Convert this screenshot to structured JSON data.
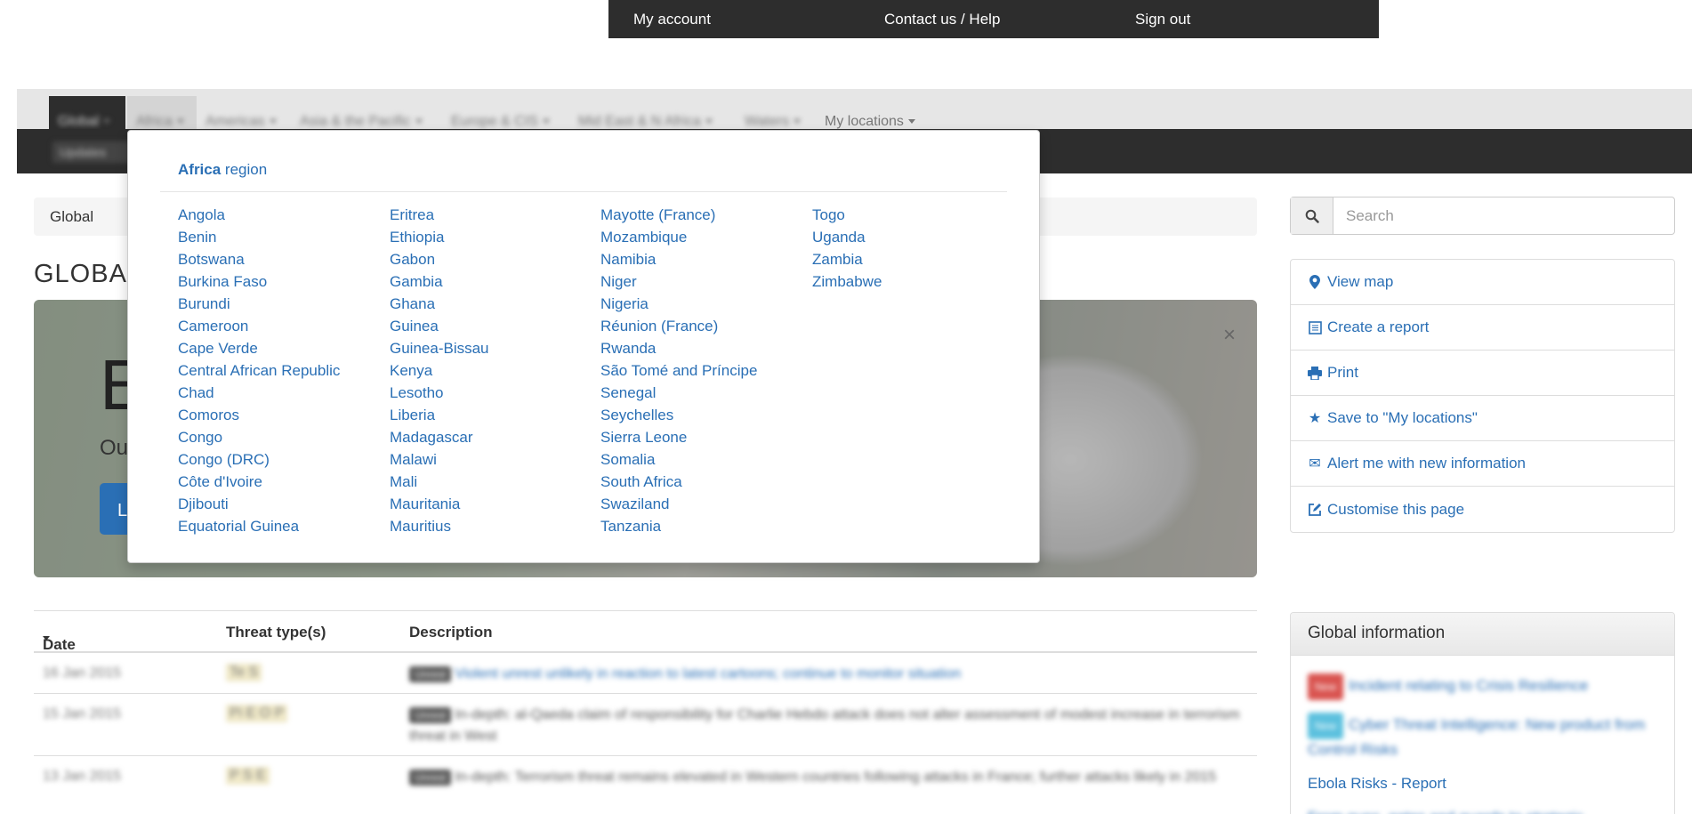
{
  "topbar": {
    "my_account": "My account",
    "contact": "Contact us / Help",
    "sign_out": "Sign out"
  },
  "nav": {
    "regions": [
      "Global",
      "Africa",
      "Americas",
      "Asia & the Pacific",
      "Europe & CIS",
      "Mid East & N Africa",
      "Waters"
    ],
    "my_locations": "My locations",
    "sub_items": [
      "Updates"
    ]
  },
  "breadcrumb": {
    "current": "Global"
  },
  "page_title": "GLOBA",
  "banner": {
    "headline": "E",
    "subline": "Ou",
    "button_label": "L",
    "close": "×"
  },
  "dropdown": {
    "header_bold": "Africa",
    "header_rest": " region",
    "columns": [
      [
        "Angola",
        "Benin",
        "Botswana",
        "Burkina Faso",
        "Burundi",
        "Cameroon",
        "Cape Verde",
        "Central African Republic",
        "Chad",
        "Comoros",
        "Congo",
        "Congo (DRC)",
        "Côte d'Ivoire",
        "Djibouti",
        "Equatorial Guinea"
      ],
      [
        "Eritrea",
        "Ethiopia",
        "Gabon",
        "Gambia",
        "Ghana",
        "Guinea",
        "Guinea-Bissau",
        "Kenya",
        "Lesotho",
        "Liberia",
        "Madagascar",
        "Malawi",
        "Mali",
        "Mauritania",
        "Mauritius"
      ],
      [
        "Mayotte (France)",
        "Mozambique",
        "Namibia",
        "Niger",
        "Nigeria",
        "Réunion (France)",
        "Rwanda",
        "São Tomé and Príncipe",
        "Senegal",
        "Seychelles",
        "Sierra Leone",
        "Somalia",
        "South Africa",
        "Swaziland",
        "Tanzania"
      ],
      [
        "Togo",
        "Uganda",
        "Zambia",
        "Zimbabwe"
      ]
    ]
  },
  "search": {
    "placeholder": "Search",
    "icon": "search-icon"
  },
  "actions": [
    {
      "label": "View map",
      "icon": "map-marker-icon"
    },
    {
      "label": "Create a report",
      "icon": "report-icon"
    },
    {
      "label": "Print",
      "icon": "print-icon"
    },
    {
      "label": "Save to \"My locations\"",
      "icon": "star-icon"
    },
    {
      "label": "Alert me with new information",
      "icon": "envelope-icon"
    },
    {
      "label": "Customise this page",
      "icon": "edit-icon"
    }
  ],
  "table": {
    "headers": {
      "date": "Date",
      "threats": "Threat type(s)",
      "description": "Description"
    },
    "rows": [
      {
        "date": "16 Jan 2015",
        "threats": "Te  S",
        "tag": "Unrest",
        "text": "Violent unrest unlikely in reaction to latest cartoons; continue to monitor situation"
      },
      {
        "date": "15 Jan 2015",
        "threats": "Pi  E  O  P",
        "tag": "Unrest",
        "text": "In-depth: al-Qaeda claim of responsibility for Charlie Hebdo attack does not alter assessment of modest increase in terrorism threat in West"
      },
      {
        "date": "13 Jan 2015",
        "threats": "P  S  E",
        "tag": "Unrest",
        "text": "In-depth: Terrorism threat remains elevated in Western countries following attacks in France; further attacks likely in 2015"
      }
    ]
  },
  "info": {
    "title": "Global information",
    "items": [
      {
        "badge": "New",
        "badge_color": "#d9534f",
        "text": "Incident relating to Crisis Resilience"
      },
      {
        "badge": "New",
        "badge_color": "#5bc0de",
        "text": "Cyber Threat Intelligence: New product from Control Risks"
      },
      {
        "badge": "",
        "badge_color": "",
        "text": "Ebola Risks - Report"
      },
      {
        "badge": "",
        "badge_color": "",
        "text": "From guns, gates and guards to strategic"
      }
    ]
  }
}
